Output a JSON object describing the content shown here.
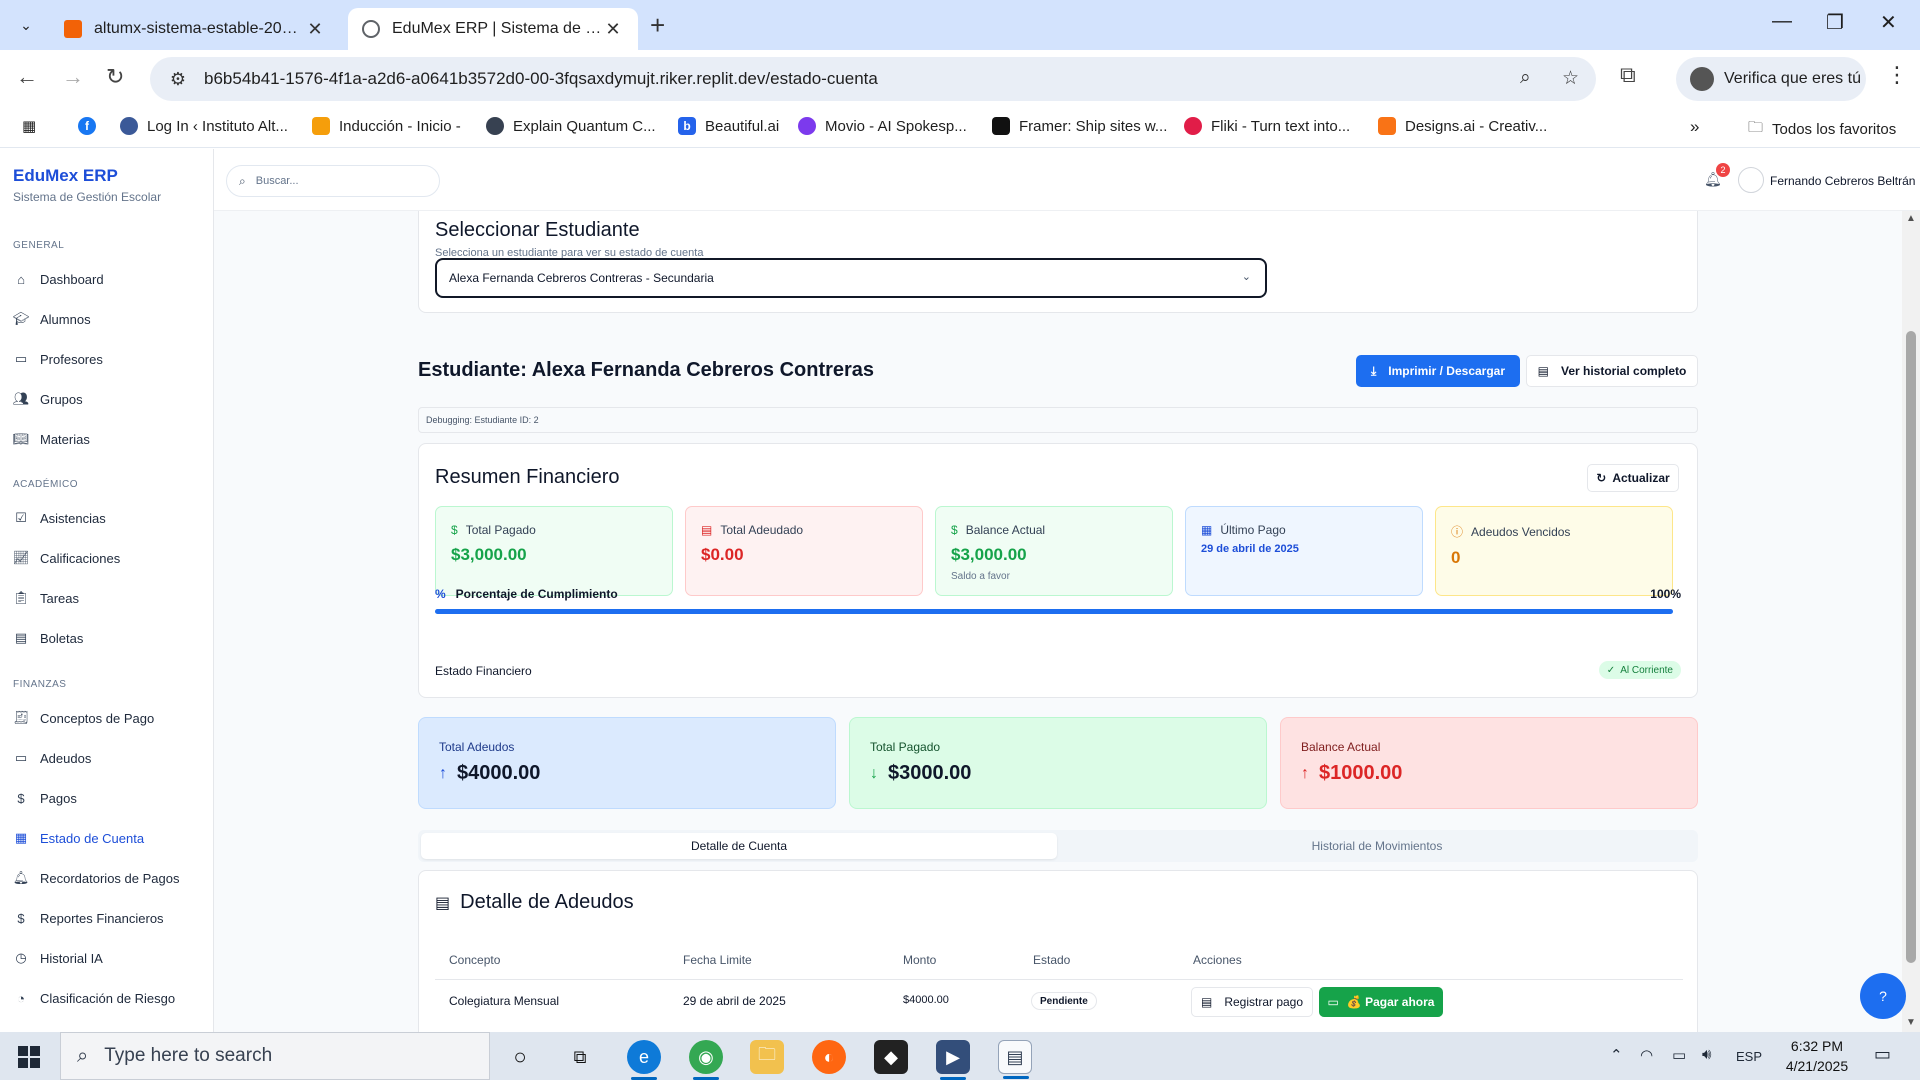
{
  "browser": {
    "tabs": [
      {
        "title": "altumx-sistema-estable-2025 - Replit",
        "favicon_color": "#f26207"
      },
      {
        "title": "EduMex ERP | Sistema de Gestión Escolar",
        "favicon_color": "#5f6368"
      }
    ],
    "url": "b6b54b41-1576-4f1a-a2d6-a0641b3572d0-00-3fqsaxdymujt.riker.replit.dev/estado-cuenta",
    "verify_label": "Verifica que eres tú",
    "bookmarks": [
      {
        "label": "Log In ‹ Instituto Alt...",
        "color": "#3b5998"
      },
      {
        "label": "Inducción - Inicio -",
        "color": "#f59e0b"
      },
      {
        "label": "Explain Quantum C...",
        "color": "#374151"
      },
      {
        "label": "Beautiful.ai",
        "color": "#2563eb"
      },
      {
        "label": "Movio - AI Spokesp...",
        "color": "#7c3aed"
      },
      {
        "label": "Framer: Ship sites w...",
        "color": "#111111"
      },
      {
        "label": "Fliki - Turn text into...",
        "color": "#e11d48"
      },
      {
        "label": "Designs.ai - Creativ...",
        "color": "#f97316"
      }
    ],
    "all_bookmarks_label": "Todos los favoritos"
  },
  "app": {
    "brand": "EduMex ERP",
    "brand_sub": "Sistema de Gestión Escolar",
    "search_placeholder": "Buscar...",
    "notifications_count": "2",
    "user_name": "Fernando Cebreros Beltrán"
  },
  "sidebar": {
    "sections": [
      {
        "title": "GENERAL",
        "items": [
          {
            "label": "Dashboard",
            "icon": "home-icon"
          },
          {
            "label": "Alumnos",
            "icon": "graduation-cap-icon"
          },
          {
            "label": "Profesores",
            "icon": "presentation-icon"
          },
          {
            "label": "Grupos",
            "icon": "users-icon"
          },
          {
            "label": "Materias",
            "icon": "book-icon"
          }
        ]
      },
      {
        "title": "ACADÉMICO",
        "items": [
          {
            "label": "Asistencias",
            "icon": "clipboard-check-icon"
          },
          {
            "label": "Calificaciones",
            "icon": "chart-line-icon"
          },
          {
            "label": "Tareas",
            "icon": "clipboard-icon"
          },
          {
            "label": "Boletas",
            "icon": "file-icon"
          }
        ]
      },
      {
        "title": "FINANZAS",
        "items": [
          {
            "label": "Conceptos de Pago",
            "icon": "receipt-icon"
          },
          {
            "label": "Adeudos",
            "icon": "credit-card-icon"
          },
          {
            "label": "Pagos",
            "icon": "dollar-icon"
          },
          {
            "label": "Estado de Cuenta",
            "icon": "file-chart-icon",
            "active": true
          },
          {
            "label": "Recordatorios de Pagos",
            "icon": "bell-icon"
          },
          {
            "label": "Reportes Financieros",
            "icon": "dollar-icon"
          },
          {
            "label": "Historial IA",
            "icon": "history-icon"
          },
          {
            "label": "Clasificación de Riesgo",
            "icon": "gauge-icon"
          }
        ]
      }
    ]
  },
  "selector": {
    "title": "Seleccionar Estudiante",
    "subtitle": "Selecciona un estudiante para ver su estado de cuenta",
    "selected": "Alexa Fernanda Cebreros Contreras - Secundaria"
  },
  "student": {
    "heading": "Estudiante: Alexa Fernanda Cebreros Contreras",
    "print_label": "Imprimir / Descargar",
    "history_label": "Ver historial completo",
    "debug": "Debugging: Estudiante ID: 2"
  },
  "summary": {
    "title": "Resumen Financiero",
    "refresh_label": "Actualizar",
    "stats": [
      {
        "label": "Total Pagado",
        "value": "$3,000.00",
        "icon": "dollar-icon",
        "sub": ""
      },
      {
        "label": "Total Adeudado",
        "value": "$0.00",
        "icon": "receipt-icon",
        "sub": ""
      },
      {
        "label": "Balance Actual",
        "value": "$3,000.00",
        "icon": "dollar-icon",
        "sub": "Saldo a favor"
      },
      {
        "label": "Último Pago",
        "value": "29 de abril de 2025",
        "icon": "calendar-icon",
        "sub": ""
      },
      {
        "label": "Adeudos Vencidos",
        "value": "0",
        "icon": "alert-circle-icon",
        "sub": ""
      }
    ],
    "progress_label": "Porcentaje de Cumplimiento",
    "progress_value": "100%",
    "progress_fraction": 1.0,
    "status_label": "Estado Financiero",
    "status_value": "Al Corriente"
  },
  "totals": [
    {
      "label": "Total Adeudos",
      "value": "$4000.00",
      "direction": "up"
    },
    {
      "label": "Total Pagado",
      "value": "$3000.00",
      "direction": "down"
    },
    {
      "label": "Balance Actual",
      "value": "$1000.00",
      "direction": "up"
    }
  ],
  "tabs": [
    "Detalle de Cuenta",
    "Historial de Movimientos"
  ],
  "detail": {
    "title": "Detalle de Adeudos",
    "columns": [
      "Concepto",
      "Fecha Limite",
      "Monto",
      "Estado",
      "Acciones"
    ],
    "rows": [
      {
        "concepto": "Colegiatura Mensual",
        "fecha": "29 de abril de 2025",
        "monto": "$4000.00",
        "estado": "Pendiente",
        "register_label": "Registrar pago",
        "pay_label": "💰 Pagar ahora"
      }
    ]
  },
  "taskbar": {
    "search_placeholder": "Type here to search",
    "lang": "ESP",
    "time": "6:32 PM",
    "date": "4/21/2025"
  },
  "colors": {
    "accent": "#1d6ef0",
    "green": "#16a34a",
    "red": "#dc2626",
    "orange": "#d97706"
  }
}
